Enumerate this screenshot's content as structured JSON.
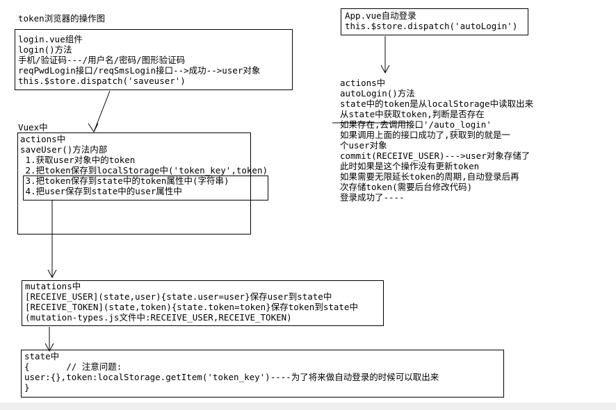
{
  "title": "token浏览器的操作图",
  "login_box": {
    "lines": [
      "login.vue组件",
      "login()方法",
      "手机/验证码---/用户名/密码/图形验证码",
      "reqPwdLogin接口/reqSmsLogin接口-->成功-->user对象",
      "this.$store.dispatch('saveuser')"
    ]
  },
  "vuex_label": "Vuex中",
  "actions_box": {
    "lines": [
      "actions中",
      "saveUser()方法内部",
      " 1.获取user对象中的token",
      " 2.把token保存到localStorage中('token_key',token)",
      " 3.把token保存到state中的token属性中(字符串)",
      " 4.把user保存到state中的user属性中"
    ]
  },
  "mutations_box": {
    "lines": [
      "mutations中",
      "[RECEIVE_USER](state,user){state.user=user}保存user到state中",
      "[RECEIVE_TOKEN](state,token){state.token=token}保存token到state中",
      "(mutation-types.js文件中:RECEIVE_USER,RECEIVE_TOKEN)"
    ]
  },
  "state_box": {
    "lines": [
      "state中",
      "{       // 注意问题:",
      "user:{},token:localStorage.getItem('token_key')----为了将来做自动登录的时候可以取出来",
      "}"
    ]
  },
  "app_box": {
    "lines": [
      "App.vue自动登录",
      "this.$store.dispatch('autoLogin')"
    ]
  },
  "right_text": {
    "lines": [
      "actions中",
      "autoLogin()方法",
      "state中的token是从localStorage中读取出来",
      "从state中获取token,判断是否存在",
      "如果存在,去调用接口'/auto_login'",
      "如果调用上面的接口成功了,获取到的就是一",
      "个user对象",
      "commit(RECEIVE_USER)--->user对象存储了",
      "此时如果是这个操作没有更新token",
      "如果需要无限延长token的周期,自动登录后再",
      "次存储token(需要后台修改代码)",
      "",
      "登录成功了----"
    ]
  }
}
